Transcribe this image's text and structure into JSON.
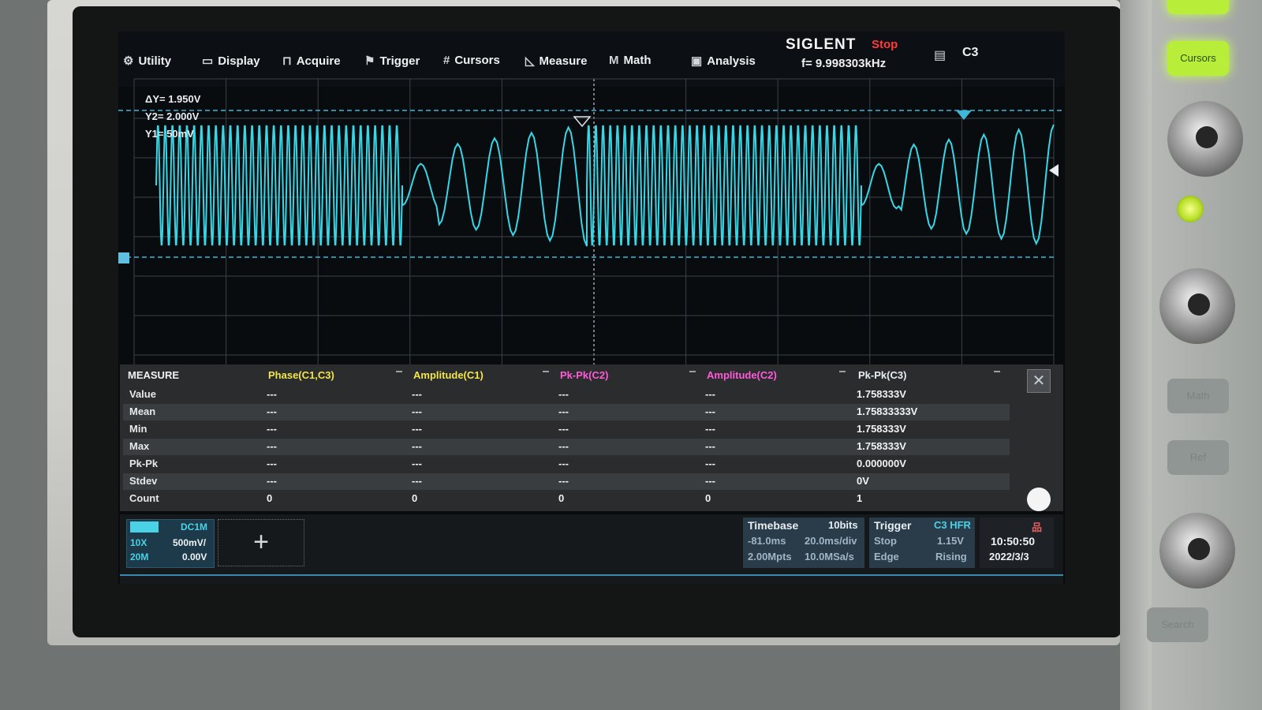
{
  "menu": {
    "items": [
      {
        "label": "Utility",
        "icon": "gear-icon"
      },
      {
        "label": "Display",
        "icon": "monitor-icon"
      },
      {
        "label": "Acquire",
        "icon": "acquire-icon"
      },
      {
        "label": "Trigger",
        "icon": "flag-icon"
      },
      {
        "label": "Cursors",
        "icon": "cursor-grid-icon"
      },
      {
        "label": "Measure",
        "icon": "measure-icon"
      },
      {
        "label": "Math",
        "icon": "math-icon"
      },
      {
        "label": "Analysis",
        "icon": "analysis-icon"
      }
    ],
    "brand": "SIGLENT",
    "run_status": "Stop",
    "frequency": "f= 9.998303kHz",
    "channel": "C3"
  },
  "cursors": {
    "delta_y": "ΔY= 1.950V",
    "y2": "Y2= 2.000V",
    "y1": "Y1= 50mV"
  },
  "waveform": {
    "color": "#39d6e6",
    "segments": [
      "fast",
      "slow",
      "fast",
      "slow"
    ]
  },
  "measure": {
    "title": "MEASURE",
    "columns": [
      {
        "label": "Phase(C1,C3)",
        "color": "#f2e64a"
      },
      {
        "label": "Amplitude(C1)",
        "color": "#f2e64a"
      },
      {
        "label": "Pk-Pk(C2)",
        "color": "#ff5ad8"
      },
      {
        "label": "Amplitude(C2)",
        "color": "#ff5ad8"
      },
      {
        "label": "Pk-Pk(C3)",
        "color": "#e8eef2"
      }
    ],
    "rows": [
      {
        "label": "Value",
        "values": [
          "---",
          "---",
          "---",
          "---",
          "1.758333V"
        ]
      },
      {
        "label": "Mean",
        "values": [
          "---",
          "---",
          "---",
          "---",
          "1.75833333V"
        ]
      },
      {
        "label": "Min",
        "values": [
          "---",
          "---",
          "---",
          "---",
          "1.758333V"
        ]
      },
      {
        "label": "Max",
        "values": [
          "---",
          "---",
          "---",
          "---",
          "1.758333V"
        ]
      },
      {
        "label": "Pk-Pk",
        "values": [
          "---",
          "---",
          "---",
          "---",
          "0.000000V"
        ]
      },
      {
        "label": "Stdev",
        "values": [
          "---",
          "---",
          "---",
          "---",
          "0V"
        ]
      },
      {
        "label": "Count",
        "values": [
          "0",
          "0",
          "0",
          "0",
          "1"
        ]
      }
    ]
  },
  "channel_box": {
    "coupling": "DC1M",
    "probe": "10X",
    "scale": "500mV/",
    "bandwidth": "20M",
    "offset": "0.00V"
  },
  "timebase": {
    "title": "Timebase",
    "bits": "10bits",
    "delay": "-81.0ms",
    "scale": "20.0ms/div",
    "points": "2.00Mpts",
    "rate": "10.0MSa/s"
  },
  "trigger": {
    "title": "Trigger",
    "source": "C3 HFR",
    "state": "Stop",
    "level": "1.15V",
    "type": "Edge",
    "slope": "Rising"
  },
  "clock": {
    "time": "10:50:50",
    "date": "2022/3/3"
  },
  "hardware": {
    "cursors_button": "Cursors",
    "math_button": "Math",
    "ref_button": "Ref",
    "search_button": "Search"
  }
}
